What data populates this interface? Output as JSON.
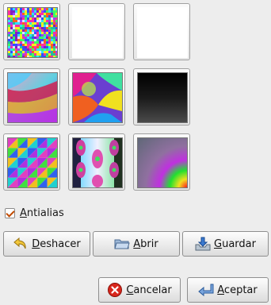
{
  "thumbnails": [
    {
      "name": "random-noise"
    },
    {
      "name": "blank-white-1"
    },
    {
      "name": "blank-white-2"
    },
    {
      "name": "color-waves"
    },
    {
      "name": "color-swirl"
    },
    {
      "name": "dark-gradient"
    },
    {
      "name": "color-tiles"
    },
    {
      "name": "cell-pattern"
    },
    {
      "name": "radial-gradient"
    }
  ],
  "antialias": {
    "label_first": "A",
    "label_rest": "ntialias",
    "checked": true
  },
  "buttons": {
    "undo": {
      "first": "D",
      "rest": "eshacer",
      "icon": "undo-arrow-icon"
    },
    "open": {
      "first": "A",
      "rest": "brir",
      "icon": "folder-icon"
    },
    "save": {
      "first": "G",
      "rest": "uardar",
      "icon": "save-icon"
    },
    "cancel": {
      "first": "C",
      "rest": "ancelar",
      "icon": "cancel-icon"
    },
    "ok": {
      "first": "A",
      "rest": "ceptar",
      "icon": "enter-icon"
    }
  },
  "colors": {
    "accent_cancel": "#d8261c",
    "window_bg": "#ededed",
    "check": "#c04a00"
  }
}
